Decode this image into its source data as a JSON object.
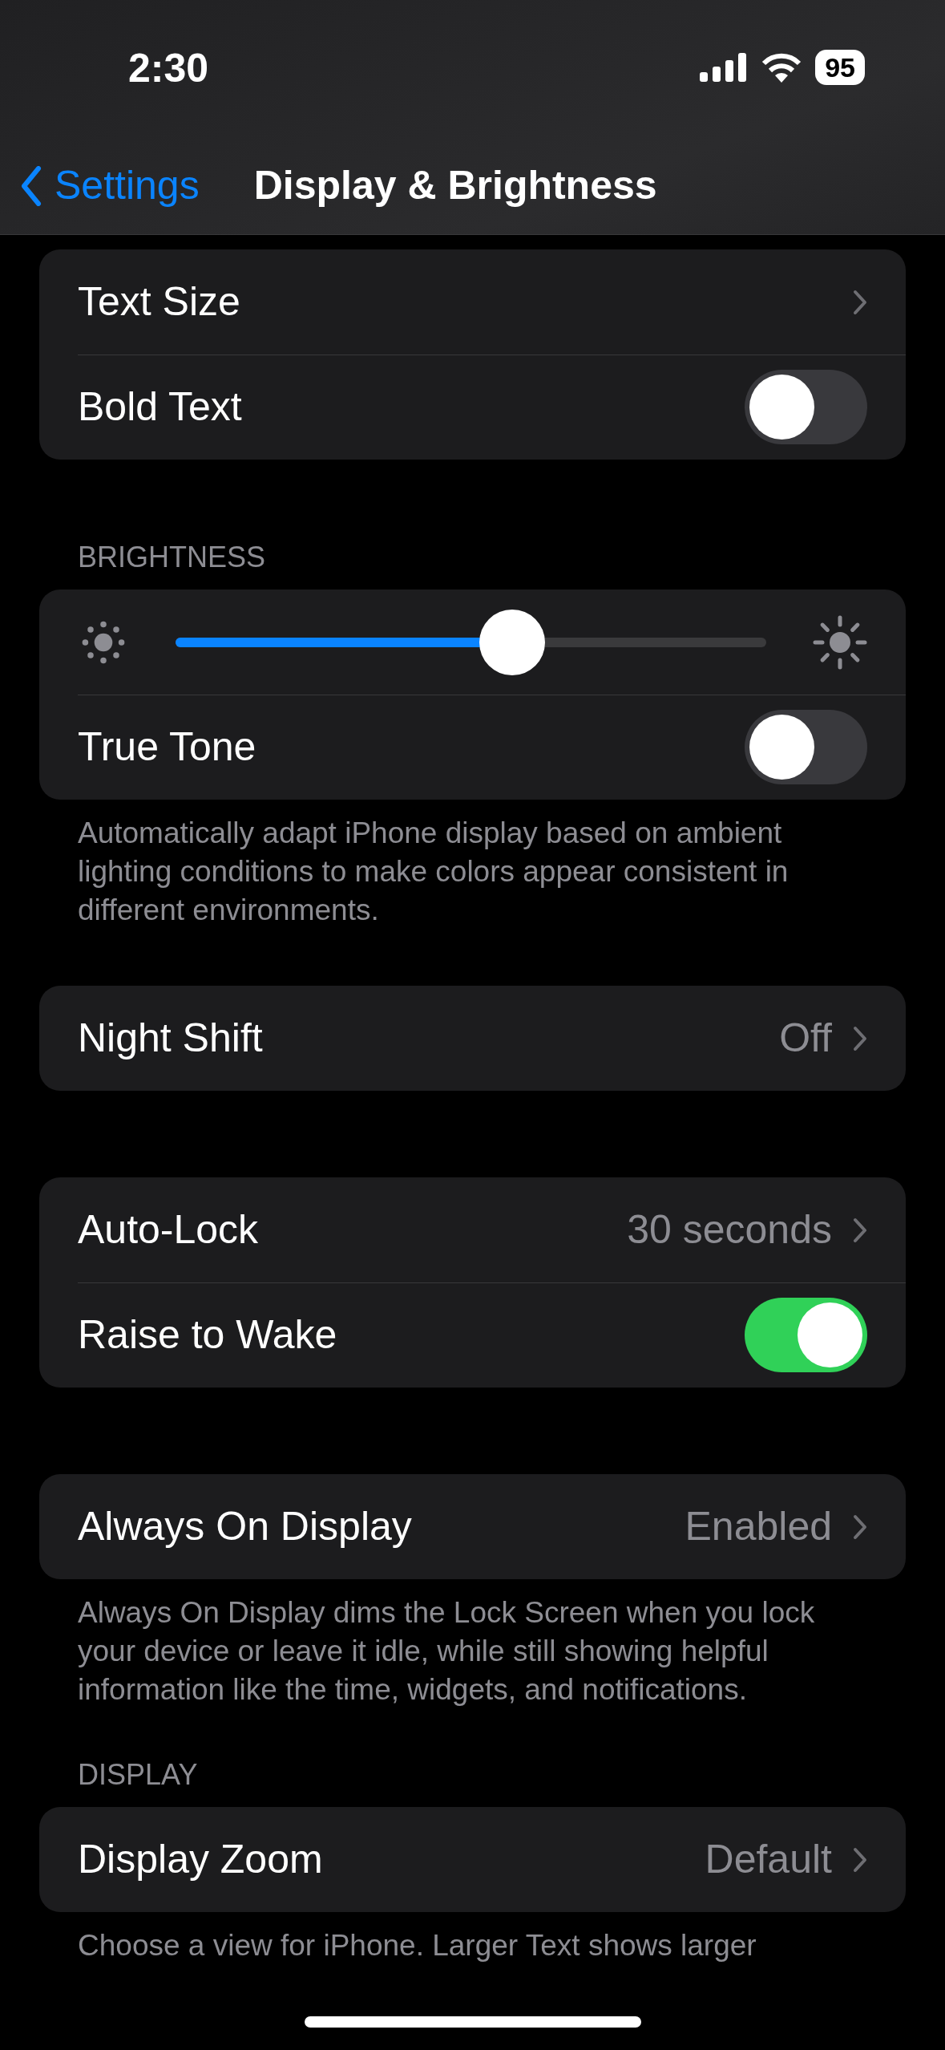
{
  "status_bar": {
    "time": "2:30",
    "battery": "95"
  },
  "nav": {
    "back": "Settings",
    "title": "Display & Brightness"
  },
  "sections": [
    {
      "rows": [
        {
          "kind": "disclosure",
          "label": "Text Size"
        },
        {
          "kind": "toggle",
          "label": "Bold Text",
          "on": false
        }
      ]
    },
    {
      "header": "BRIGHTNESS",
      "rows": [
        {
          "kind": "slider",
          "level": 0.57
        },
        {
          "kind": "toggle",
          "label": "True Tone",
          "on": false
        }
      ],
      "footer": "Automatically adapt iPhone display based on ambient lighting conditions to make colors appear consistent in different environments."
    },
    {
      "rows": [
        {
          "kind": "disclosure",
          "label": "Night Shift",
          "value": "Off"
        }
      ]
    },
    {
      "rows": [
        {
          "kind": "disclosure",
          "label": "Auto-Lock",
          "value": "30 seconds"
        },
        {
          "kind": "toggle",
          "label": "Raise to Wake",
          "on": true
        }
      ]
    },
    {
      "rows": [
        {
          "kind": "disclosure",
          "label": "Always On Display",
          "value": "Enabled"
        }
      ],
      "footer": "Always On Display dims the Lock Screen when you lock your device or leave it idle, while still showing helpful information like the time, widgets, and notifications."
    },
    {
      "header": "DISPLAY",
      "rows": [
        {
          "kind": "disclosure",
          "label": "Display Zoom",
          "value": "Default"
        }
      ],
      "footer": "Choose a view for iPhone. Larger Text shows larger"
    }
  ]
}
